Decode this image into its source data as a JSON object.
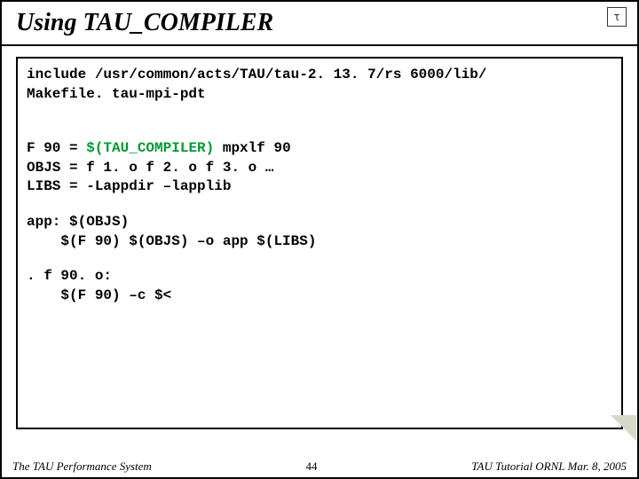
{
  "title": "Using TAU_COMPILER",
  "logo": "τ",
  "code": {
    "include1": "include /usr/common/acts/TAU/tau-2. 13. 7/rs 6000/lib/",
    "include2": "Makefile. tau-mpi-pdt",
    "f90_lhs": "F 90 = ",
    "f90_green": "$(TAU_COMPILER)",
    "f90_rhs": " mpxlf 90",
    "objs": "OBJS = f 1. o f 2. o f 3. o …",
    "libs": "LIBS = -Lappdir –lapplib",
    "app1": "app: $(OBJS)",
    "app2": "    $(F 90) $(OBJS) –o app $(LIBS)",
    "rule1": ". f 90. o:",
    "rule2": "    $(F 90) –c $<"
  },
  "footer": {
    "left": "The TAU Performance System",
    "center": "44",
    "right": "TAU Tutorial ORNL Mar. 8, 2005"
  }
}
